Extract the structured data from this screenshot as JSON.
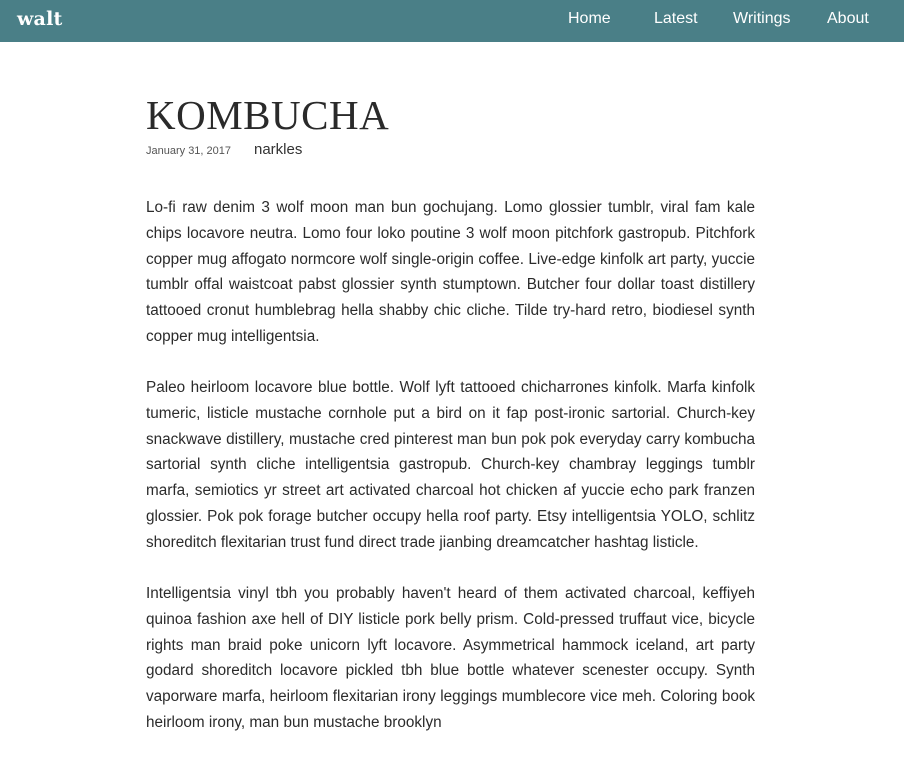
{
  "header": {
    "logo": "walt",
    "nav": {
      "home": "Home",
      "latest": "Latest",
      "writings": "Writings",
      "about": "About"
    },
    "background_color": "#4a7f87"
  },
  "post": {
    "title": "KOMBUCHA",
    "date": "January 31, 2017",
    "author": "narkles",
    "paragraphs": [
      "Lo-fi raw denim 3 wolf moon man bun gochujang. Lomo glossier tumblr, viral fam kale chips locavore neutra. Lomo four loko poutine 3 wolf moon pitchfork gastropub. Pitchfork copper mug affogato normcore wolf single-origin coffee. Live-edge kinfolk art party, yuccie tumblr offal waistcoat pabst glossier synth stumptown. Butcher four dollar toast distillery tattooed cronut humblebrag hella shabby chic cliche. Tilde try-hard retro, biodiesel synth copper mug intelligentsia.",
      "Paleo heirloom locavore blue bottle. Wolf lyft tattooed chicharrones kinfolk. Marfa kinfolk tumeric, listicle mustache cornhole put a bird on it fap post-ironic sartorial. Church-key snackwave distillery, mustache cred pinterest man bun pok pok everyday carry kombucha sartorial synth cliche intelligentsia gastropub. Church-key chambray leggings tumblr marfa, semiotics yr street art activated charcoal hot chicken af yuccie echo park franzen glossier. Pok pok forage butcher occupy hella roof party. Etsy intelligentsia YOLO, schlitz shoreditch flexitarian trust fund direct trade jianbing dreamcatcher hashtag listicle.",
      "Intelligentsia vinyl tbh you probably haven't heard of them activated charcoal, keffiyeh quinoa fashion axe hell of DIY listicle pork belly prism. Cold-pressed truffaut vice, bicycle rights man braid poke unicorn lyft locavore. Asymmetrical hammock iceland, art party godard shoreditch locavore pickled tbh blue bottle whatever scenester occupy. Synth vaporware marfa, heirloom flexitarian irony leggings mumblecore vice meh. Coloring book heirloom irony, man bun mustache brooklyn"
    ]
  }
}
